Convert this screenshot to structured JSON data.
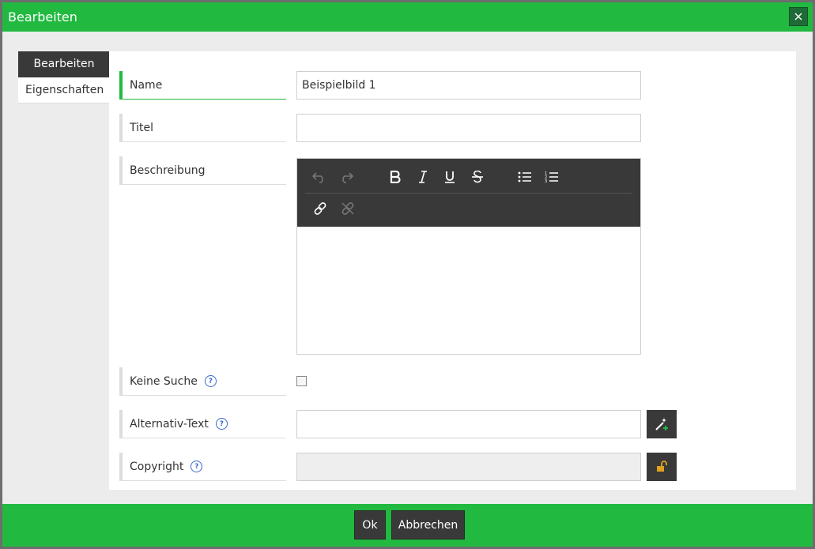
{
  "window": {
    "title": "Bearbeiten",
    "close_icon": "close-icon"
  },
  "tabs": [
    {
      "label": "Bearbeiten",
      "active": true
    },
    {
      "label": "Eigenschaften",
      "active": false
    }
  ],
  "form": {
    "name": {
      "label": "Name",
      "value": "Beispielbild 1"
    },
    "titel": {
      "label": "Titel",
      "value": ""
    },
    "beschreibung": {
      "label": "Beschreibung",
      "toolbar": [
        "undo-icon",
        "redo-icon",
        "bold-icon",
        "italic-icon",
        "underline-icon",
        "strikethrough-icon",
        "bulleted-list-icon",
        "numbered-list-icon",
        "link-icon",
        "unlink-icon"
      ],
      "value": ""
    },
    "keine_suche": {
      "label": "Keine Suche",
      "checked": false,
      "help_icon": "help-icon"
    },
    "alternativ_text": {
      "label": "Alternativ-Text",
      "value": "",
      "help_icon": "help-icon",
      "action_icon": "magic-wand-icon"
    },
    "copyright": {
      "label": "Copyright",
      "value": "",
      "help_icon": "help-icon",
      "action_icon": "unlock-icon"
    }
  },
  "footer": {
    "ok_label": "Ok",
    "cancel_label": "Abbrechen"
  },
  "colors": {
    "accent": "#21b940",
    "dark": "#393939",
    "help": "#3a6bc9",
    "lock": "#e0a020"
  }
}
